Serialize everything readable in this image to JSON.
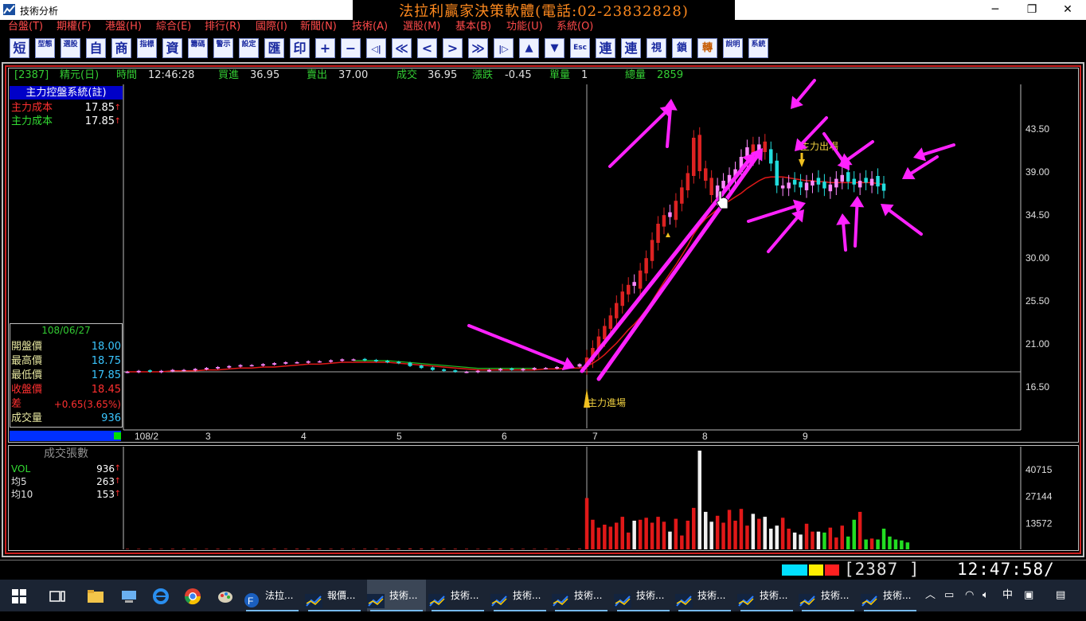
{
  "window": {
    "title": "技術分析",
    "banner": "法拉利贏家決策軟體(電話:02-23832828)",
    "controls": [
      "─",
      "❐",
      "✕"
    ]
  },
  "menu": [
    "台盤(T)",
    "期權(F)",
    "港盤(H)",
    "綜合(E)",
    "排行(R)",
    "國際(I)",
    "新聞(N)",
    "技術(A)",
    "選股(M)",
    "基本(B)",
    "功能(U)",
    "系統(O)"
  ],
  "toolbar": [
    "短",
    "型態",
    "選股",
    "自",
    "商",
    "指標",
    "資",
    "籌碼",
    "警示",
    "設定",
    "匯",
    "印",
    "+",
    "−",
    "◁|",
    "≪",
    "<",
    ">",
    "≫",
    "|▷",
    "▲",
    "▼",
    "Esc",
    "連",
    "連",
    "視",
    "鎖",
    "轉",
    "說明",
    "系統"
  ],
  "quote": {
    "code": "[2387]",
    "name": "精元(日)",
    "time_label": "時間",
    "time": "12:46:28",
    "bid_label": "買進",
    "bid": "36.95",
    "ask_label": "賣出",
    "ask": "37.00",
    "deal_label": "成交",
    "deal": "36.95",
    "change_label": "漲跌",
    "change": "-0.45",
    "lot_label": "單量",
    "lot": "1",
    "total_label": "總量",
    "total": "2859"
  },
  "side_panel": {
    "header": "主力控盤系統(註)",
    "rows": [
      {
        "label": "主力成本",
        "value": "17.85",
        "color": "#ff3030"
      },
      {
        "label": "主力成本",
        "value": "17.85",
        "color": "#33dd33"
      }
    ],
    "date": "108/06/27",
    "ohlc": [
      {
        "label": "開盤價",
        "value": "18.00",
        "vcolor": "#3ac6ff",
        "lcolor": "#e6e6a0"
      },
      {
        "label": "最高價",
        "value": "18.75",
        "vcolor": "#3ac6ff",
        "lcolor": "#e6e6a0"
      },
      {
        "label": "最低價",
        "value": "17.85",
        "vcolor": "#3ac6ff",
        "lcolor": "#e6e6a0"
      },
      {
        "label": "收盤價",
        "value": "18.45",
        "vcolor": "#ff3030",
        "lcolor": "#ff3030"
      },
      {
        "label": "差",
        "value": "+0.65(3.65%)",
        "vcolor": "#ff3030",
        "lcolor": "#ff3030"
      },
      {
        "label": "成交量",
        "value": "936",
        "vcolor": "#3ac6ff",
        "lcolor": "#e6e6a0"
      }
    ]
  },
  "volume_panel": {
    "header": "成交張數",
    "rows": [
      {
        "label": "VOL",
        "value": "936",
        "color": "#33dd33"
      },
      {
        "label": "均5",
        "value": "263",
        "color": "#e0e0e0"
      },
      {
        "label": "均10",
        "value": "153",
        "color": "#e0e0e0"
      }
    ]
  },
  "chart_data": [
    {
      "type": "candlestick",
      "title": "",
      "price_axis_ticks": [
        "43.50",
        "39.00",
        "34.50",
        "30.00",
        "25.50",
        "21.00",
        "16.50"
      ],
      "price_axis_values": [
        43.5,
        39.0,
        34.5,
        30.0,
        25.5,
        21.0,
        16.5
      ],
      "ylim": [
        12.5,
        47.5
      ],
      "x_ticks": [
        "108/2",
        "3",
        "4",
        "5",
        "6",
        "7",
        "8",
        "9"
      ],
      "annotations": {
        "entry": "主力進場",
        "exit": "主力出場"
      },
      "reference_price": 18.0,
      "series": [
        {
          "name": "price",
          "close": [
            18.0,
            18.1,
            18.0,
            18.1,
            18.2,
            18.2,
            18.3,
            18.4,
            18.5,
            18.6,
            18.7,
            18.7,
            18.8,
            18.9,
            19.0,
            19.0,
            19.1,
            19.1,
            19.2,
            19.3,
            19.3,
            19.2,
            19.1,
            19.0,
            18.9,
            18.6,
            18.4,
            18.2,
            18.1,
            18.0,
            18.0,
            18.1,
            18.2,
            18.3,
            18.2,
            18.3,
            18.4,
            18.4,
            18.5,
            18.6,
            18.8,
            19.5,
            20.5,
            21.7,
            22.8,
            23.9,
            25.2,
            26.4,
            27.1,
            27.0,
            28.6,
            29.9,
            31.8,
            33.5,
            34.4,
            34.2,
            35.9,
            37.3,
            38.8,
            42.5,
            39.0,
            38.0,
            36.5,
            37.5,
            38.0,
            38.6,
            39.2,
            40.5,
            41.5,
            40.8,
            41.8,
            41.0,
            39.8,
            37.5,
            37.5,
            37.8,
            37.6,
            37.3,
            37.8,
            38.0,
            37.6,
            37.2,
            37.6,
            38.2,
            38.6,
            37.9,
            37.6,
            38.0,
            37.8,
            38.2,
            37.4,
            36.95
          ],
          "up": [
            true,
            true,
            false,
            true,
            true,
            true,
            true,
            true,
            true,
            true,
            true,
            true,
            true,
            true,
            true,
            true,
            true,
            true,
            true,
            true,
            true,
            false,
            false,
            false,
            false,
            false,
            false,
            false,
            false,
            false,
            true,
            true,
            true,
            true,
            false,
            true,
            true,
            true,
            true,
            true,
            true,
            true,
            true,
            true,
            true,
            true,
            true,
            true,
            true,
            false,
            true,
            true,
            true,
            true,
            true,
            false,
            true,
            true,
            true,
            true,
            false,
            false,
            false,
            true,
            true,
            true,
            true,
            true,
            true,
            false,
            true,
            false,
            false,
            false,
            true,
            true,
            false,
            false,
            true,
            true,
            false,
            false,
            true,
            true,
            true,
            false,
            false,
            true,
            false,
            true,
            false,
            false
          ]
        },
        {
          "name": "ma",
          "values": [
            18.0,
            18.0,
            18.0,
            18.0,
            18.1,
            18.1,
            18.1,
            18.2,
            18.2,
            18.3,
            18.4,
            18.4,
            18.5,
            18.5,
            18.6,
            18.7,
            18.8,
            18.8,
            18.9,
            19.0,
            19.0,
            19.0,
            19.0,
            19.0,
            18.9,
            18.8,
            18.7,
            18.6,
            18.5,
            18.4,
            18.3,
            18.2,
            18.2,
            18.2,
            18.2,
            18.2,
            18.2,
            18.3,
            18.3,
            18.4,
            18.4,
            18.6,
            18.9,
            19.3,
            19.8,
            20.4,
            21.0,
            21.7,
            22.4,
            23.0,
            23.7,
            24.5,
            25.4,
            26.4,
            27.4,
            28.3,
            29.2,
            30.2,
            31.2,
            32.4,
            33.3,
            34.0,
            34.5,
            35.0,
            35.5,
            35.9,
            36.3,
            36.7,
            37.2,
            37.6,
            38.0,
            38.3,
            38.4,
            38.4,
            38.4,
            38.3,
            38.2,
            38.1,
            38.0,
            38.0,
            37.9,
            37.9,
            37.8,
            37.8,
            37.8,
            37.8,
            37.8,
            37.8,
            37.8,
            37.8,
            37.7,
            37.6
          ]
        },
        {
          "name": "volume",
          "values": [
            300,
            280,
            300,
            260,
            310,
            320,
            290,
            300,
            330,
            300,
            280,
            310,
            300,
            350,
            320,
            360,
            400,
            380,
            340,
            320,
            300,
            350,
            380,
            420,
            400,
            500,
            450,
            400,
            380,
            350,
            320,
            300,
            330,
            350,
            310,
            290,
            300,
            320,
            330,
            350,
            400,
            26000,
            15000,
            11000,
            12500,
            11500,
            13500,
            16500,
            8500,
            14500,
            15000,
            16000,
            13500,
            16500,
            14000,
            9000,
            15500,
            7000,
            14500,
            21000,
            50000,
            19000,
            14000,
            17000,
            13500,
            20000,
            14500,
            20500,
            12000,
            18000,
            15500,
            16500,
            10500,
            12000,
            16000,
            10500,
            8500,
            7500,
            13000,
            9000,
            9000,
            8500,
            11000,
            6000,
            12000,
            6500,
            15000,
            19000,
            5000,
            5500,
            5000,
            10500,
            6500,
            5000,
            4500,
            3500
          ],
          "axis_ticks": [
            "40715",
            "27144",
            "13572"
          ],
          "axis_values": [
            40715,
            27144,
            13572
          ],
          "ylim": [
            0,
            56000
          ]
        }
      ]
    }
  ],
  "statusbar": {
    "code": "[2387   ]",
    "time": "12:47:58/"
  },
  "taskbar": {
    "items": [
      {
        "label": "法拉...",
        "active": false
      },
      {
        "label": "報價...",
        "active": false
      },
      {
        "label": "技術...",
        "active": true
      },
      {
        "label": "技術...",
        "active": false
      },
      {
        "label": "技術...",
        "active": false
      },
      {
        "label": "技術...",
        "active": false
      },
      {
        "label": "技術...",
        "active": false
      },
      {
        "label": "技術...",
        "active": false
      },
      {
        "label": "技術...",
        "active": false
      },
      {
        "label": "技術...",
        "active": false
      },
      {
        "label": "技術...",
        "active": false
      }
    ],
    "ime": "中"
  }
}
